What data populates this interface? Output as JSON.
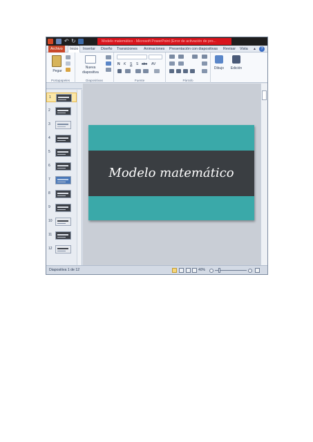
{
  "window": {
    "title": "Modelo matemático - Microsoft PowerPoint (Error de activación de pro..."
  },
  "tabs": [
    {
      "label": "Archivo"
    },
    {
      "label": "Inicio"
    },
    {
      "label": "Insertar"
    },
    {
      "label": "Diseño"
    },
    {
      "label": "Transiciones"
    },
    {
      "label": "Animaciones"
    },
    {
      "label": "Presentación con diapositivas"
    },
    {
      "label": "Revisar"
    },
    {
      "label": "Vista"
    }
  ],
  "ribbon": {
    "paste_label": "Pegar",
    "new_slide_label_1": "Nueva",
    "new_slide_label_2": "diapositiva",
    "draw_label": "Dibujo",
    "edit_label": "Edición",
    "font_buttons": [
      "N",
      "K",
      "S",
      "S",
      "abc",
      "AV"
    ],
    "groups": {
      "clipboard": "Portapapeles",
      "slides": "Diapositivas",
      "font": "Fuente",
      "paragraph": "Párrafo"
    }
  },
  "thumbnails": [
    "1",
    "2",
    "3",
    "4",
    "5",
    "6",
    "7",
    "8",
    "9",
    "10",
    "11",
    "12"
  ],
  "slide": {
    "title": "Modelo matemático"
  },
  "status": {
    "slide_counter": "Diapositiva 1 de 12",
    "zoom": "40%"
  },
  "colors": {
    "slide_teal": "#3aa9a9",
    "slide_band": "#3a3e42",
    "title_bar_red": "#d8141c",
    "file_tab": "#c9472a"
  }
}
